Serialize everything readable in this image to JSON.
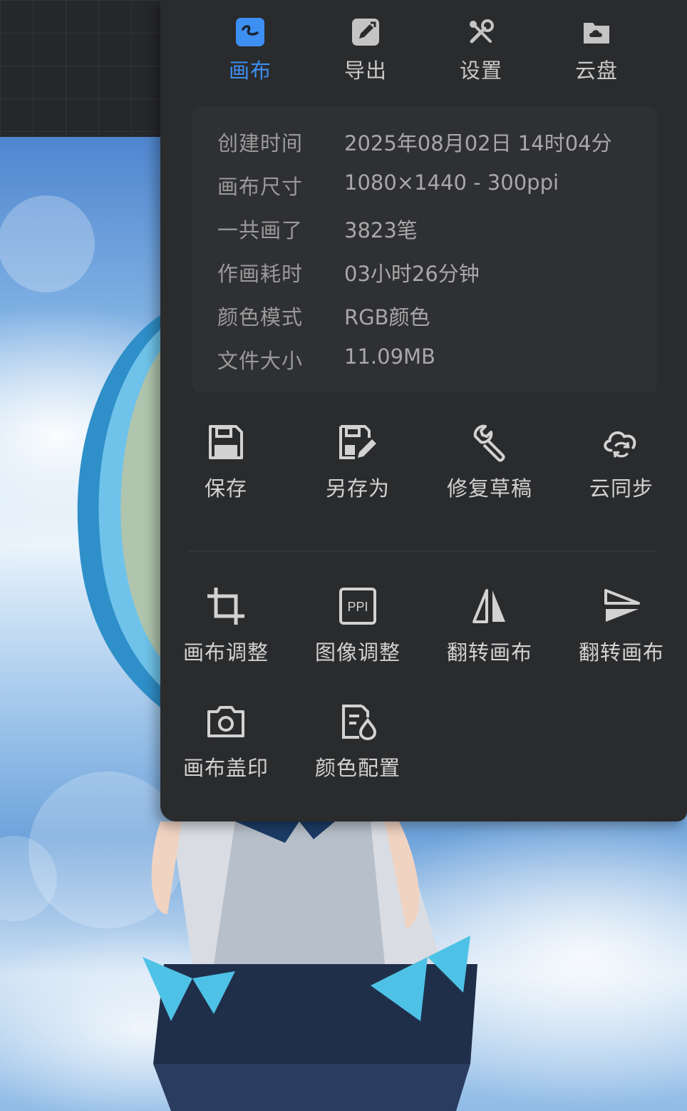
{
  "colors": {
    "accent": "#3d8ff2",
    "panel_bg": "#2a2b2d",
    "info_bg": "#2f3033",
    "text_primary": "#d2d2d2",
    "text_secondary": "#9a9a9a"
  },
  "tabs": [
    {
      "label": "画布",
      "icon": "canvas-icon",
      "active": true
    },
    {
      "label": "导出",
      "icon": "export-icon",
      "active": false
    },
    {
      "label": "设置",
      "icon": "settings-icon",
      "active": false
    },
    {
      "label": "云盘",
      "icon": "cloud-drive-icon",
      "active": false
    }
  ],
  "info": {
    "rows": [
      {
        "key": "创建时间",
        "value": "2025年08月02日 14时04分"
      },
      {
        "key": "画布尺寸",
        "value": "1080×1440 - 300ppi"
      },
      {
        "key": "一共画了",
        "value": "3823笔"
      },
      {
        "key": "作画耗时",
        "value": "03小时26分钟"
      },
      {
        "key": "颜色模式",
        "value": "RGB颜色"
      },
      {
        "key": "文件大小",
        "value": "11.09MB"
      }
    ]
  },
  "actions": [
    {
      "label": "保存",
      "icon": "save-icon"
    },
    {
      "label": "另存为",
      "icon": "save-as-icon"
    },
    {
      "label": "修复草稿",
      "icon": "repair-draft-icon"
    },
    {
      "label": "云同步",
      "icon": "cloud-sync-icon"
    }
  ],
  "tools": [
    {
      "label": "画布调整",
      "icon": "crop-icon"
    },
    {
      "label": "图像调整",
      "icon": "ppi-icon",
      "icon_text": "PPI"
    },
    {
      "label": "翻转画布",
      "icon": "flip-horizontal-icon"
    },
    {
      "label": "翻转画布",
      "icon": "flip-vertical-icon"
    },
    {
      "label": "画布盖印",
      "icon": "camera-icon"
    },
    {
      "label": "颜色配置",
      "icon": "color-profile-icon"
    }
  ]
}
